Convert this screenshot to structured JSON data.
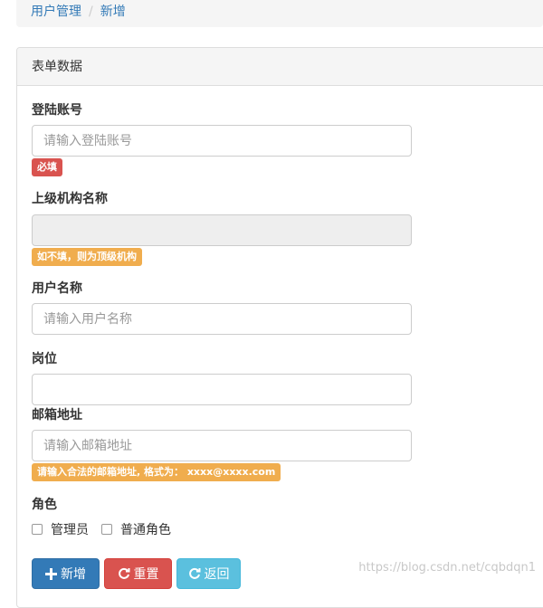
{
  "breadcrumb": {
    "parent": "用户管理",
    "separator": "/",
    "current": "新增"
  },
  "panel": {
    "title": "表单数据"
  },
  "form": {
    "login_account": {
      "label": "登陆账号",
      "placeholder": "请输入登陆账号",
      "hint": "必填"
    },
    "parent_org": {
      "label": "上级机构名称",
      "hint": "如不填，则为顶级机构"
    },
    "user_name": {
      "label": "用户名称",
      "placeholder": "请输入用户名称"
    },
    "position": {
      "label": "岗位",
      "placeholder": ""
    },
    "email": {
      "label": "邮箱地址",
      "placeholder": "请输入邮箱地址",
      "hint": "请输入合法的邮箱地址, 格式为： xxxx@xxxx.com"
    },
    "role": {
      "label": "角色",
      "options": [
        "管理员",
        "普通角色"
      ]
    }
  },
  "buttons": {
    "add": "新增",
    "reset": "重置",
    "back": "返回"
  },
  "watermark": "https://blog.csdn.net/cqbdqn1",
  "colors": {
    "primary": "#337ab7",
    "danger": "#d9534f",
    "info": "#5bc0de",
    "warning": "#f0ad4e"
  },
  "icons": {
    "add": "plus-icon",
    "reset": "refresh-icon",
    "back": "refresh-icon"
  }
}
